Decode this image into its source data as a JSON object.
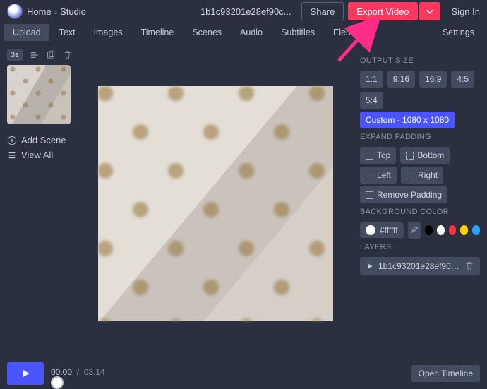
{
  "breadcrumb": {
    "home": "Home",
    "sep": "›",
    "current": "Studio"
  },
  "doc_title": "1b1c93201e28ef90c...",
  "actions": {
    "share": "Share",
    "export": "Export Video",
    "signin": "Sign In"
  },
  "tabs": {
    "items": [
      {
        "label": "Upload",
        "active": true
      },
      {
        "label": "Text"
      },
      {
        "label": "Images"
      },
      {
        "label": "Timeline"
      },
      {
        "label": "Scenes"
      },
      {
        "label": "Audio"
      },
      {
        "label": "Subtitles"
      },
      {
        "label": "Elements"
      }
    ],
    "right": {
      "settings": "Settings"
    }
  },
  "left": {
    "duration": "3s",
    "add_scene": "Add Scene",
    "view_all": "View All"
  },
  "right": {
    "output_size_label": "OUTPUT SIZE",
    "ratios": [
      {
        "label": "1:1"
      },
      {
        "label": "9:16"
      },
      {
        "label": "16:9"
      },
      {
        "label": "4:5"
      },
      {
        "label": "5:4"
      }
    ],
    "custom_label": "Custom - 1080 x 1080",
    "expand_label": "EXPAND PADDING",
    "padding": {
      "top": "Top",
      "bottom": "Bottom",
      "left": "Left",
      "right": "Right",
      "remove": "Remove Padding"
    },
    "bg_label": "BACKGROUND COLOR",
    "bg_value": "#ffffff",
    "presets": [
      {
        "color": "#000000"
      },
      {
        "color": "#ffffff"
      },
      {
        "color": "#ff3249"
      },
      {
        "color": "#ffd400"
      },
      {
        "color": "#2aa3ff"
      }
    ],
    "layers_label": "LAYERS",
    "layer_name": "1b1c93201e28ef90cac..."
  },
  "bottom": {
    "current": "00.00",
    "sep": "/",
    "total": "03.14",
    "open_timeline": "Open Timeline"
  }
}
